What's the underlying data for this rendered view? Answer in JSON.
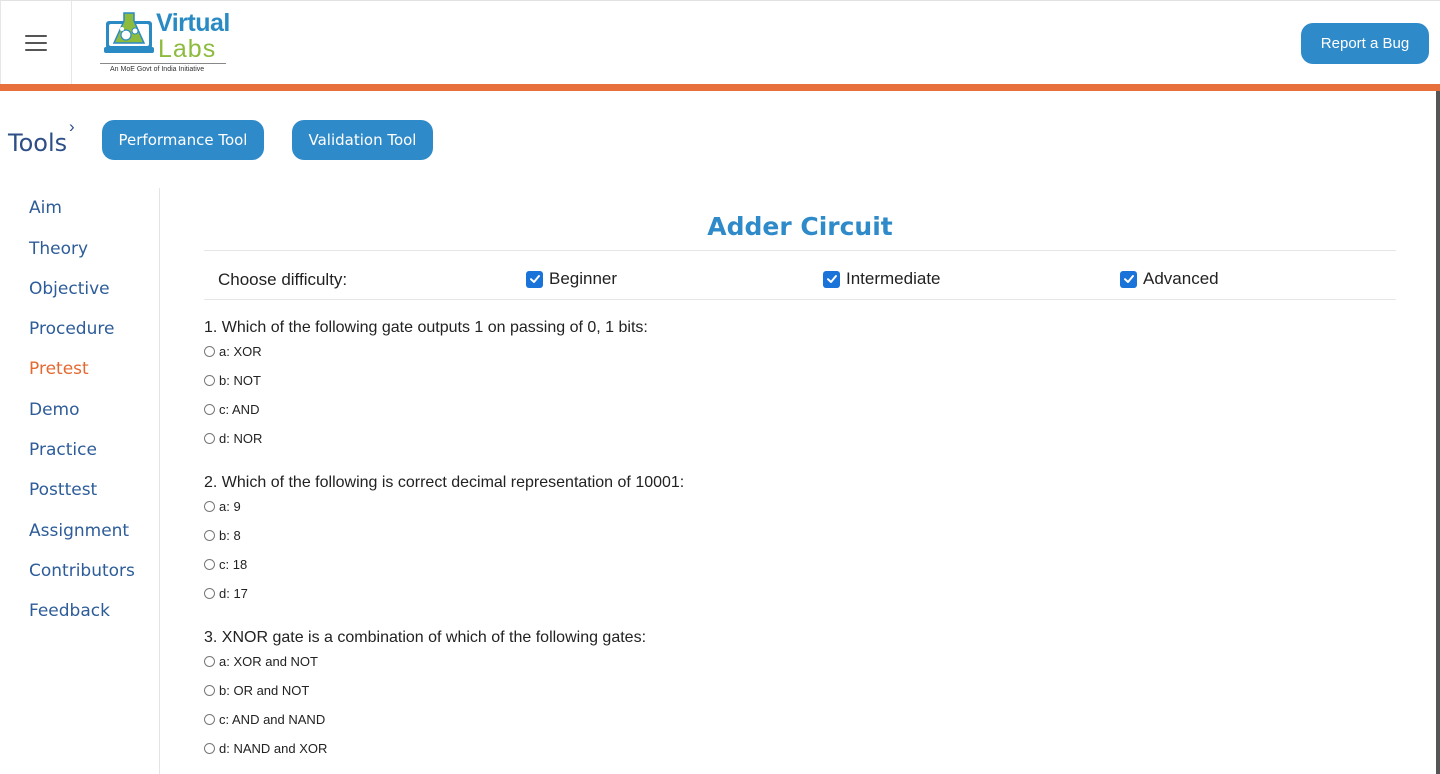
{
  "header": {
    "logo": {
      "line1": "Virtual",
      "line2": "Labs",
      "tagline": "An MoE Govt of India Initiative"
    },
    "report_bug_label": "Report a Bug"
  },
  "tools": {
    "label": "Tools",
    "buttons": [
      "Performance Tool",
      "Validation Tool"
    ]
  },
  "sidebar": {
    "items": [
      "Aim",
      "Theory",
      "Objective",
      "Procedure",
      "Pretest",
      "Demo",
      "Practice",
      "Posttest",
      "Assignment",
      "Contributors",
      "Feedback"
    ],
    "active": "Pretest"
  },
  "main": {
    "title": "Adder Circuit",
    "difficulty": {
      "label": "Choose difficulty:",
      "options": [
        {
          "label": "Beginner",
          "checked": true
        },
        {
          "label": "Intermediate",
          "checked": true
        },
        {
          "label": "Advanced",
          "checked": true
        }
      ]
    },
    "questions": [
      {
        "text": "1. Which of the following gate outputs 1 on passing of 0, 1 bits:",
        "options": [
          "a: XOR",
          "b: NOT",
          "c: AND",
          "d: NOR"
        ]
      },
      {
        "text": "2. Which of the following is correct decimal representation of 10001:",
        "options": [
          "a: 9",
          "b: 8",
          "c: 18",
          "d: 17"
        ]
      },
      {
        "text": "3. XNOR gate is a combination of which of the following gates:",
        "options": [
          "a: XOR and NOT",
          "b: OR and NOT",
          "c: AND and NAND",
          "d: NAND and XOR"
        ]
      }
    ]
  },
  "colors": {
    "brand_blue": "#2f8ac9",
    "accent_orange": "#e8703c",
    "nav_blue": "#2d5c99",
    "active_orange": "#e4682f",
    "checkbox_blue": "#1a73d9"
  }
}
